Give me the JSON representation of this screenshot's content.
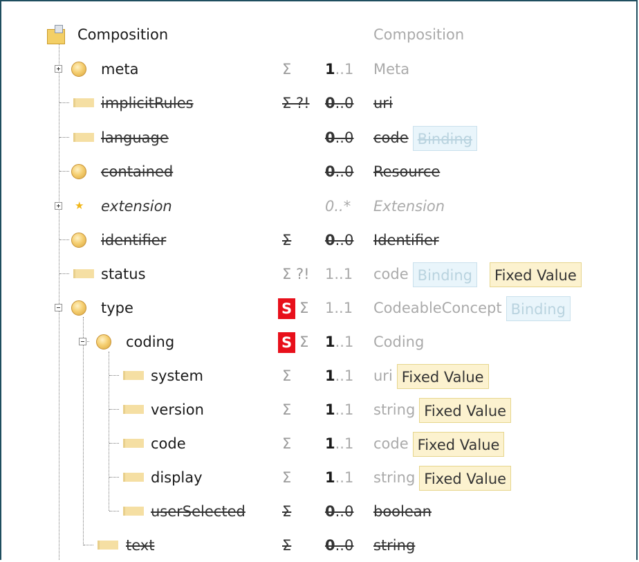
{
  "rows": [
    {
      "name": "Composition",
      "flags": "",
      "min": "",
      "max": "",
      "type": "Composition",
      "badges": []
    },
    {
      "name": "meta",
      "flags": "Σ",
      "min": "1",
      "max": "..1",
      "type": "Meta",
      "badges": []
    },
    {
      "name": "implicitRules",
      "flags": "Σ ?!",
      "min": "0",
      "max": "..0",
      "type": "uri",
      "badges": []
    },
    {
      "name": "language",
      "flags": "",
      "min": "0",
      "max": "..0",
      "type": "code",
      "badges": [
        "Binding"
      ]
    },
    {
      "name": "contained",
      "flags": "",
      "min": "0",
      "max": "..0",
      "type": "Resource",
      "badges": []
    },
    {
      "name": "extension",
      "flags": "",
      "min": "0",
      "max": "..*",
      "type": "Extension",
      "badges": []
    },
    {
      "name": "identifier",
      "flags": "Σ",
      "min": "0",
      "max": "..0",
      "type": "Identifier",
      "badges": []
    },
    {
      "name": "status",
      "flags": "Σ ?!",
      "min": "1",
      "max": "..1",
      "type": "code",
      "badges": [
        "Binding",
        "Fixed Value"
      ]
    },
    {
      "name": "type",
      "flags": "Σ",
      "sflag": "S",
      "min": "1",
      "max": "..1",
      "type": "CodeableConcept",
      "badges": [
        "Binding"
      ]
    },
    {
      "name": "coding",
      "flags": "Σ",
      "sflag": "S",
      "min": "1",
      "max": "..1",
      "type": "Coding",
      "badges": []
    },
    {
      "name": "system",
      "flags": "Σ",
      "min": "1",
      "max": "..1",
      "type": "uri",
      "badges": [
        "Fixed Value"
      ]
    },
    {
      "name": "version",
      "flags": "Σ",
      "min": "1",
      "max": "..1",
      "type": "string",
      "badges": [
        "Fixed Value"
      ]
    },
    {
      "name": "code",
      "flags": "Σ",
      "min": "1",
      "max": "..1",
      "type": "code",
      "badges": [
        "Fixed Value"
      ]
    },
    {
      "name": "display",
      "flags": "Σ",
      "min": "1",
      "max": "..1",
      "type": "string",
      "badges": [
        "Fixed Value"
      ]
    },
    {
      "name": "userSelected",
      "flags": "Σ",
      "min": "0",
      "max": "..0",
      "type": "boolean",
      "badges": []
    },
    {
      "name": "text",
      "flags": "Σ",
      "min": "0",
      "max": "..0",
      "type": "string",
      "badges": []
    }
  ]
}
